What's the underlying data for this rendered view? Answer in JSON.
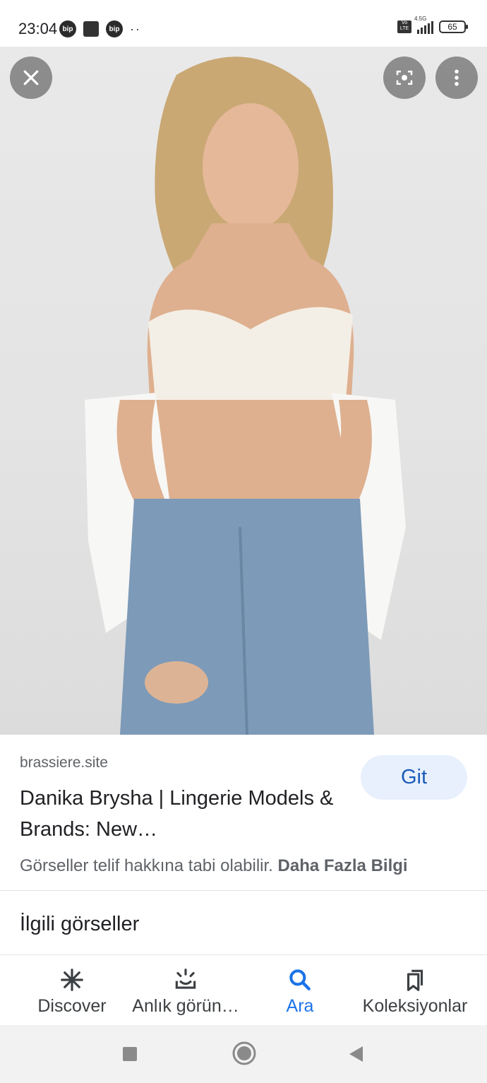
{
  "status_bar": {
    "time": "23:04",
    "notification_icons": [
      "bip",
      "app",
      "bip"
    ],
    "overflow": "··",
    "volte_label": "Vo LTE",
    "network": "4.5G",
    "battery": "65"
  },
  "image_viewer": {
    "image_description": "photo",
    "close_icon": "close-icon",
    "lens_icon": "lens-icon",
    "more_icon": "more-vert-icon"
  },
  "result": {
    "source": "brassiere.site",
    "title": "Danika Brysha | Lingerie Models & Brands: New…",
    "go_label": "Git",
    "copyright_text": "Görseller telif hakkına tabi olabilir.",
    "more_info_label": "Daha Fazla Bilgi"
  },
  "related": {
    "heading": "İlgili görseller"
  },
  "bottom_nav": {
    "items": [
      {
        "label": "Discover",
        "icon": "asterisk-icon"
      },
      {
        "label": "Anlık görün…",
        "icon": "snapshot-icon"
      },
      {
        "label": "Ara",
        "icon": "search-icon"
      },
      {
        "label": "Koleksiyonlar",
        "icon": "collections-icon"
      }
    ],
    "active_index": 2,
    "active_color": "#1a73e8"
  },
  "system_nav": {
    "recents_icon": "square-icon",
    "home_icon": "circle-icon",
    "back_icon": "triangle-back-icon"
  }
}
